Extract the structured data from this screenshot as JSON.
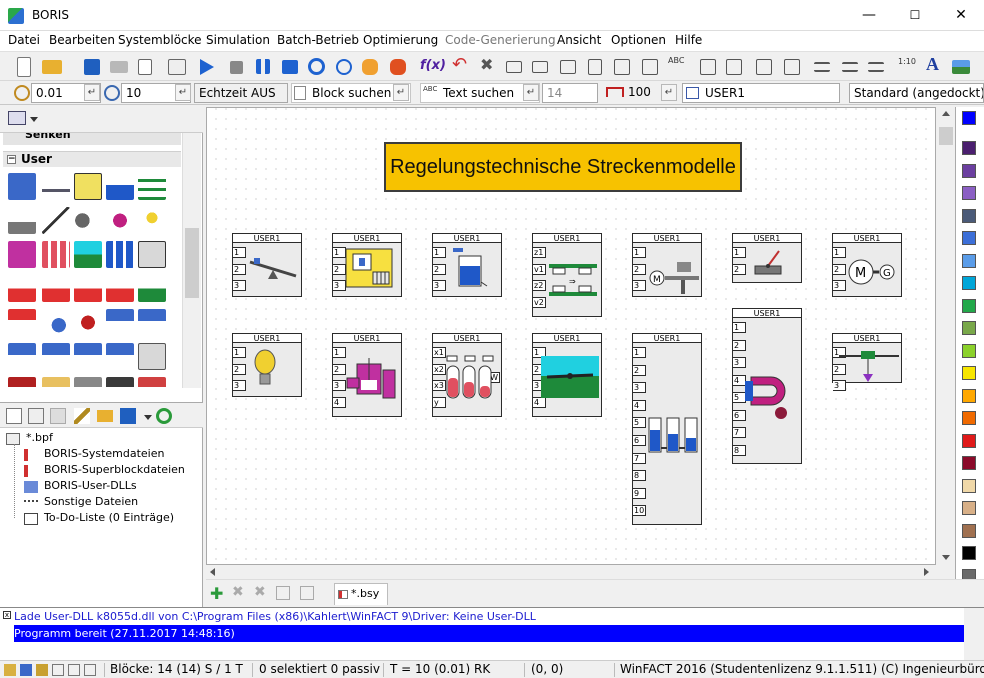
{
  "window": {
    "title": "BORIS",
    "minimize": "—",
    "maximize": "☐",
    "close": "✕"
  },
  "menu": [
    {
      "label": "Datei",
      "enabled": true
    },
    {
      "label": "Bearbeiten",
      "enabled": true
    },
    {
      "label": "Systemblöcke",
      "enabled": true
    },
    {
      "label": "Simulation",
      "enabled": true
    },
    {
      "label": "Batch-Betrieb",
      "enabled": true
    },
    {
      "label": "Optimierung",
      "enabled": true
    },
    {
      "label": "Code-Generierung",
      "enabled": false
    },
    {
      "label": "Ansicht",
      "enabled": true
    },
    {
      "label": "Optionen",
      "enabled": true
    },
    {
      "label": "Hilfe",
      "enabled": true
    }
  ],
  "toolbar2": {
    "step_size": "0.01",
    "sim_time": "10",
    "realtime": "Echtzeit AUS",
    "block_search_placeholder": "Block suchen",
    "text_search_placeholder": "Text suchen",
    "font_size": "14",
    "zoom": "100",
    "block_type": "USER1",
    "dock_mode": "Standard (angedockt)"
  },
  "left_panel": {
    "prev_group": "Senken",
    "group": "User",
    "tree_root": "*.bpf",
    "tree_items": [
      "BORIS-Systemdateien",
      "BORIS-Superblockdateien",
      "BORIS-User-DLLs",
      "Sonstige Dateien",
      "To-Do-Liste (0 Einträge)"
    ]
  },
  "canvas": {
    "title": "Regelungstechnische Streckenmodelle",
    "blocks": [
      {
        "name": "USER1",
        "ports": [
          "1",
          "2",
          "3"
        ],
        "art": "seesaw"
      },
      {
        "name": "USER1",
        "ports": [
          "1",
          "2",
          "3"
        ],
        "art": "heater"
      },
      {
        "name": "USER1",
        "ports": [
          "1",
          "2",
          "3"
        ],
        "art": "tank"
      },
      {
        "name": "USER1",
        "ports": [
          "z1",
          "v1",
          "z2",
          "v2"
        ],
        "art": "cars"
      },
      {
        "name": "USER1",
        "ports": [
          "1",
          "2",
          "3"
        ],
        "art": "motor-lift"
      },
      {
        "name": "USER1",
        "ports": [
          "1",
          "2"
        ],
        "art": "pendulum"
      },
      {
        "name": "USER1",
        "ports": [
          "1",
          "2",
          "3"
        ],
        "art": "motor-gen"
      },
      {
        "name": "USER1",
        "ports": [
          "1",
          "2",
          "3"
        ],
        "art": "lamp"
      },
      {
        "name": "USER1",
        "ports": [
          "1",
          "2",
          "3",
          "4"
        ],
        "art": "reactor"
      },
      {
        "name": "USER1",
        "ports": [
          "x1",
          "x2",
          "x3",
          "y"
        ],
        "art": "tubes",
        "side_label": "3/W"
      },
      {
        "name": "USER1",
        "ports": [
          "1",
          "2",
          "3",
          "4"
        ],
        "art": "plane"
      },
      {
        "name": "USER1",
        "ports": [
          "1",
          "2",
          "3",
          "4",
          "5",
          "6",
          "7",
          "8",
          "9",
          "10"
        ],
        "art": "three-tanks"
      },
      {
        "name": "USER1",
        "ports": [
          "1",
          "2",
          "3",
          "4",
          "5",
          "6",
          "7",
          "8"
        ],
        "art": "magnet"
      },
      {
        "name": "USER1",
        "ports": [
          "1",
          "2",
          "3"
        ],
        "art": "crane"
      }
    ]
  },
  "tab": {
    "label": "*.bsy"
  },
  "messages": {
    "line1": "Lade User-DLL k8055d.dll von C:\\Program Files (x86)\\Kahlert\\WinFACT 9\\Driver: Keine User-DLL",
    "line2": "Programm bereit   (27.11.2017 14:48:16)"
  },
  "status": {
    "blocks": "Blöcke: 14 (14) S / 1 T",
    "selected": "0 selektiert  0 passiv",
    "time": "T = 10  (0.01)  RK",
    "coords": "(0, 0)",
    "license": "WinFACT 2016 (Studentenlizenz 9.1.1.511)  (C) Ingenieurbüro Dr. K"
  },
  "colors": {
    "accent": "#0000ff",
    "title_box": "#f7c200",
    "palette": [
      "#0000ff",
      "#4b1f6f",
      "#6b3fa0",
      "#8b5fc4",
      "#4a5a78",
      "#3c6fd8",
      "#5a9ce8",
      "#00a6d8",
      "#22a84a",
      "#79a84a",
      "#8bd12b",
      "#f7e600",
      "#ffa800",
      "#f06a00",
      "#e01a1a",
      "#8b0a2a",
      "#f0d8a8",
      "#d8b088",
      "#a07050",
      "#000000",
      "#6a6a6a"
    ]
  }
}
